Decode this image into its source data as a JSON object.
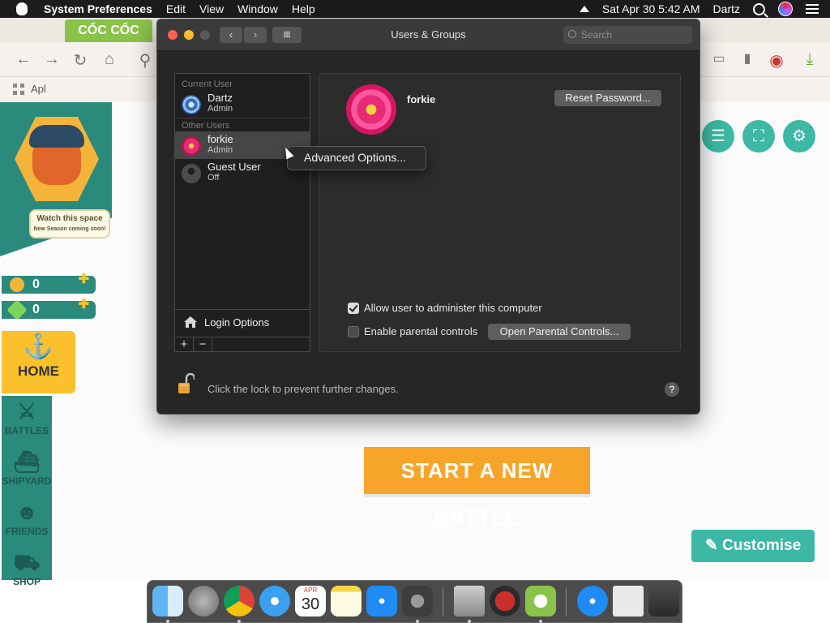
{
  "menubar": {
    "app_name": "System Preferences",
    "menus": [
      "Edit",
      "View",
      "Window",
      "Help"
    ],
    "datetime": "Sat Apr 30  5:42 AM",
    "user": "Dartz"
  },
  "browser": {
    "tab_label": "CỐC CỐC",
    "bookmark_label": "Apl"
  },
  "game": {
    "watch_title": "Watch this space",
    "watch_sub": "New Season coming soon!",
    "coins": "0",
    "gems": "0",
    "home": "HOME",
    "nav": [
      "BATTLES",
      "SHIPYARD",
      "FRIENDS",
      "SHOP"
    ],
    "start_battle": "START A NEW BATTLE",
    "customise": "Customise"
  },
  "window": {
    "title": "Users & Groups",
    "search_placeholder": "Search",
    "current_user_header": "Current User",
    "other_users_header": "Other Users",
    "users": [
      {
        "name": "Dartz",
        "role": "Admin"
      },
      {
        "name": "forkie",
        "role": "Admin"
      },
      {
        "name": "Guest User",
        "role": "Off"
      }
    ],
    "login_options": "Login Options",
    "add_label": "+",
    "remove_label": "−",
    "selected_user_name": "forkie",
    "reset_password": "Reset Password...",
    "allow_admin": "Allow user to administer this computer",
    "allow_admin_checked": true,
    "enable_parental": "Enable parental controls",
    "enable_parental_checked": false,
    "open_parental": "Open Parental Controls...",
    "lock_message": "Click the lock to prevent further changes.",
    "help_label": "?"
  },
  "context_menu": {
    "item": "Advanced Options..."
  },
  "dock": {
    "calendar_month": "APR",
    "calendar_day": "30"
  },
  "colors": {
    "accent_teal": "#3cb8a4",
    "game_orange": "#f7a52a",
    "window_bg": "#262626"
  }
}
